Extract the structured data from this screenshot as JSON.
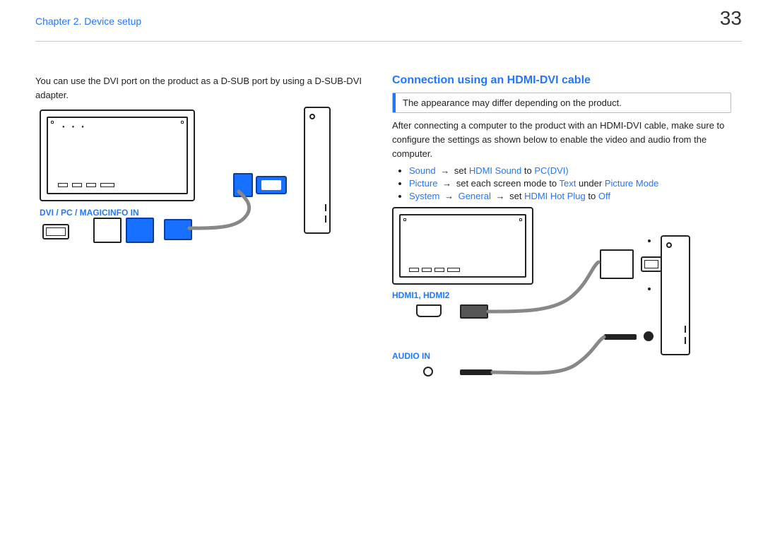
{
  "header": {
    "chapter": "Chapter 2. Device setup",
    "page": "33"
  },
  "left": {
    "intro": "You can use the DVI port on the product as a D-SUB port by using a D-SUB-DVI adapter.",
    "port_label": "DVI / PC / MAGICINFO IN"
  },
  "right": {
    "title": "Connection using an HDMI-DVI cable",
    "callout": "The appearance may differ depending on the product.",
    "intro": "After connecting a computer to the product with an HDMI-DVI cable, make sure to configure the settings as shown below to enable the video and audio from the computer.",
    "bul1": {
      "a": "Sound",
      "arrow": "→",
      "mid": "set",
      "b": "HDMI Sound",
      "to": "to",
      "c": "PC(DVI)"
    },
    "bul2": {
      "a": "Picture",
      "arrow": "→",
      "mid": "set each screen mode to",
      "b": "Text",
      "under": "under",
      "c": "Picture Mode"
    },
    "bul3": {
      "a": "System",
      "arrow": "→",
      "b": "General",
      "arrow2": "→",
      "mid": "set",
      "c": "HDMI Hot Plug",
      "to": "to",
      "d": "Off"
    },
    "hdmi_label": "HDMI1, HDMI2",
    "audio_label": "AUDIO IN"
  }
}
